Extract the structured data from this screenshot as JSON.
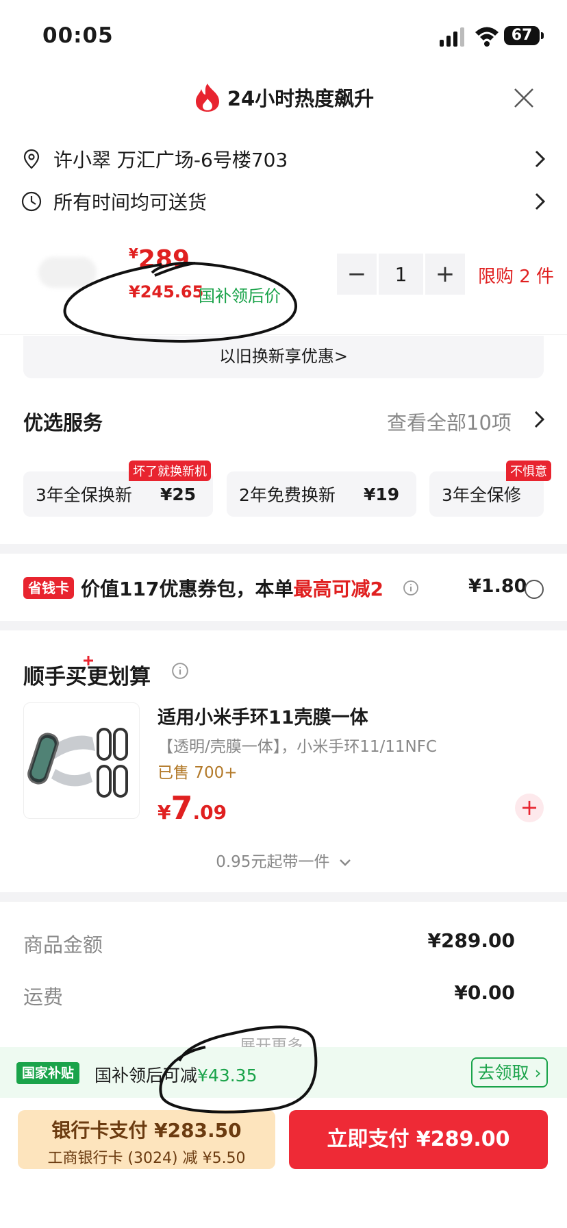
{
  "status_bar": {
    "time": "00:05",
    "battery": "67"
  },
  "header": {
    "title": "24小时热度飙升"
  },
  "address": {
    "text": "许小翠 万汇广场-6号楼703"
  },
  "delivery": {
    "text": "所有时间均可送货"
  },
  "price": {
    "currency": "¥",
    "original": "289",
    "subsidy_price": "¥245.65",
    "subsidy_label": "国补领后价",
    "quantity": "1",
    "minus": "−",
    "plus": "+",
    "limit": "限购 2 件"
  },
  "tradein": {
    "text": "以旧换新享优惠>"
  },
  "services": {
    "title": "优选服务",
    "view_all": "查看全部10项",
    "items": [
      {
        "name": "3年全保换新",
        "price": "¥25",
        "tag": "坏了就换新机"
      },
      {
        "name": "2年免费换新",
        "price": "¥19",
        "tag": ""
      },
      {
        "name": "3年全保修",
        "price": "",
        "tag": "不惧意"
      }
    ]
  },
  "savings_card": {
    "badge": "省钱卡",
    "text_prefix": "价值117优惠券包，本单",
    "text_highlight": "最高可减2",
    "amount": "¥1.80"
  },
  "bundle": {
    "title": "顺手买",
    "title_suffix": "更划算",
    "product": {
      "title": "适用小米手环11壳膜一体",
      "desc": "【透明/壳膜一体】，小米手环11/11NFC",
      "sold": "已售 700+",
      "currency": "¥",
      "price_int": "7",
      "price_dec": ".09"
    },
    "more": "0.95元起带一件"
  },
  "summary": {
    "goods_label": "商品金额",
    "goods_value": "¥289.00",
    "shipping_label": "运费",
    "shipping_value": "¥0.00",
    "expand": "展开更多"
  },
  "subsidy": {
    "badge": "国家补贴",
    "text": "国补领后可减",
    "amount": "¥43.35",
    "button": "去领取"
  },
  "payment": {
    "bank_title": "银行卡支付 ¥283.50",
    "bank_sub": "工商银行卡 (3024) 减 ¥5.50",
    "pay_now": "立即支付 ¥289.00"
  },
  "colors": {
    "accent_red": "#e8242f",
    "subsidy_green": "#1aa34a",
    "bank_bg": "#fde4bd"
  }
}
